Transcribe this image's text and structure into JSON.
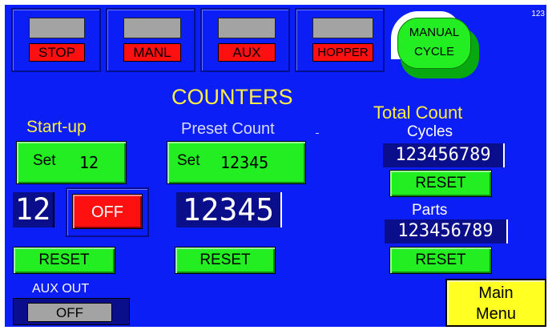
{
  "top_bar": {
    "indicators": [
      {
        "label": "STOP"
      },
      {
        "label": "MANL"
      },
      {
        "label": "AUX"
      },
      {
        "label": "HOPPER"
      }
    ],
    "manual_cycle": {
      "line1": "MANUAL",
      "line2": "CYCLE"
    },
    "corner_number": "123"
  },
  "title": "COUNTERS",
  "startup": {
    "label": "Start-up",
    "set_prefix": "Set",
    "set_value": "12",
    "display_value": "12",
    "toggle_label": "OFF",
    "reset_label": "RESET"
  },
  "preset": {
    "label": "Preset Count",
    "set_prefix": "Set",
    "set_value": "12345",
    "display_value": "12345",
    "reset_label": "RESET"
  },
  "total": {
    "label": "Total Count",
    "cycles_label": "Cycles",
    "cycles_value": "123456789",
    "cycles_reset": "RESET",
    "parts_label": "Parts",
    "parts_value": "123456789",
    "parts_reset": "RESET"
  },
  "aux_out": {
    "label": "AUX OUT",
    "value": "OFF"
  },
  "main_menu": {
    "line1": "Main",
    "line2": "Menu"
  },
  "colors": {
    "background": "#0a1ef5",
    "button_green": "#22ee22",
    "indicator_red": "#ff1010",
    "title_yellow": "#ffee44",
    "menu_yellow": "#ffff22"
  }
}
